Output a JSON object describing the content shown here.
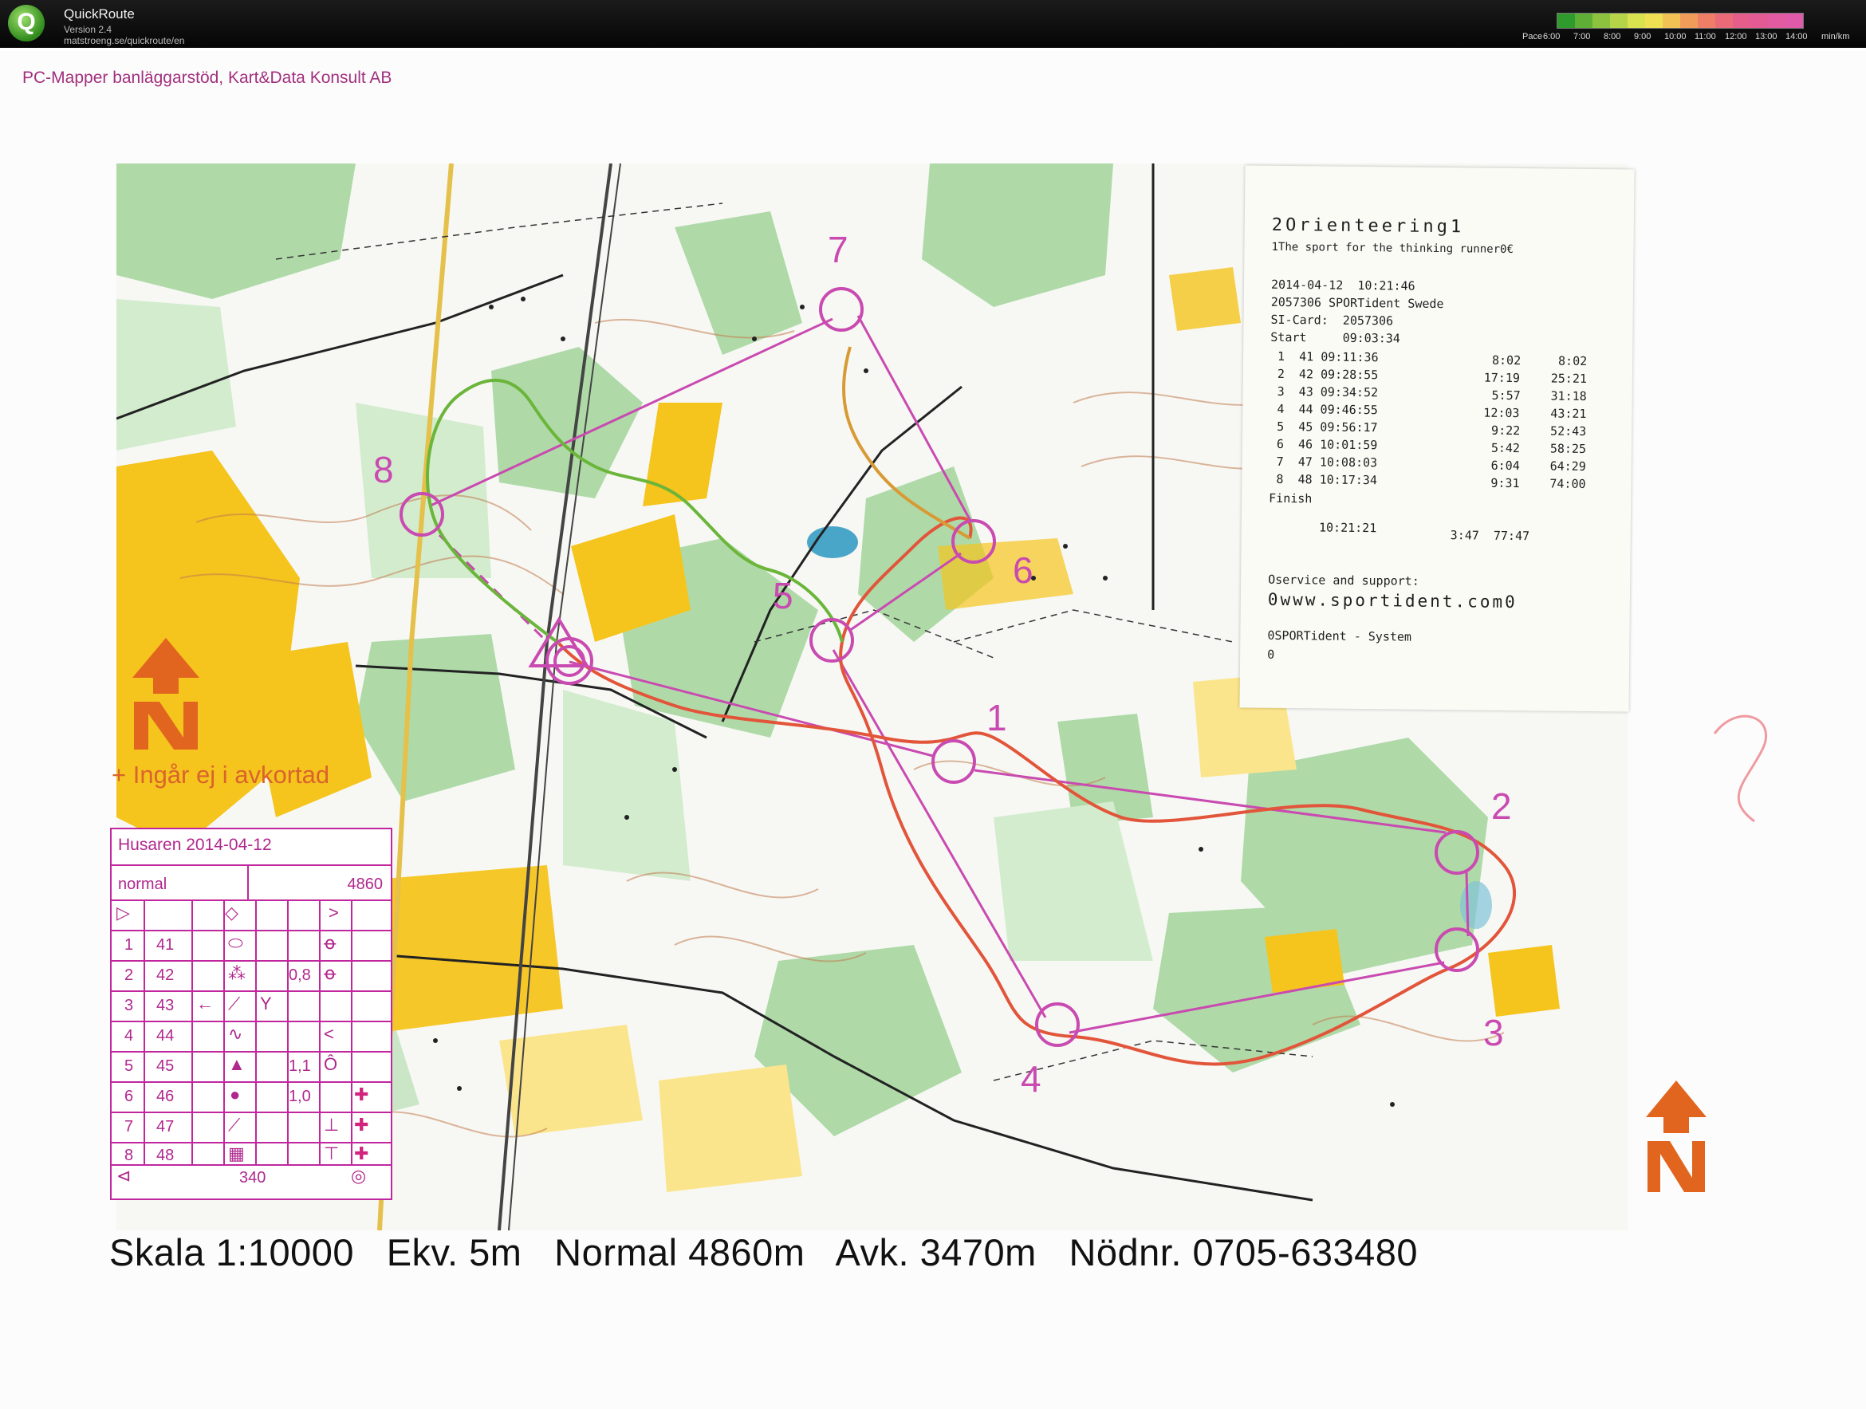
{
  "app": {
    "name": "QuickRoute",
    "version": "Version 2.4",
    "url": "matstroeng.se/quickroute/en",
    "logo_letter": "Q"
  },
  "pace_legend": {
    "label": "Pace",
    "ticks": [
      "6:00",
      "7:00",
      "8:00",
      "9:00",
      "10:00",
      "11:00",
      "12:00",
      "13:00",
      "14:00"
    ],
    "unit": "min/km",
    "colors": [
      "#2f9b2d",
      "#5fae35",
      "#8cc23e",
      "#b5d448",
      "#d9e24f",
      "#efe152",
      "#f3c255",
      "#f29c5a",
      "#ee7e66",
      "#ea6a78",
      "#e55d8a",
      "#e45a95",
      "#e25aa0",
      "#df5aa8"
    ]
  },
  "map": {
    "header_credit": "PC-Mapper banläggarstöd, Kart&Data Konsult AB",
    "orange_note": "+ Ingår ej i avkortad",
    "footer": "Skala 1:10000   Ekv. 5m   Normal 4860m   Avk. 3470m   Nödnr. 0705-633480",
    "control_numbers": [
      "1",
      "2",
      "3",
      "4",
      "5",
      "6",
      "7",
      "8"
    ],
    "colors": {
      "forest_green": "#9fd39a",
      "open_yellow": "#f7c424",
      "course_magenta": "#c94ab0",
      "route_red": "#e2553a",
      "north_orange": "#e2651f"
    }
  },
  "punch_card": {
    "line1": "2Orienteering1",
    "line2": "1The sport for the thinking runner0€",
    "datetime": "2014-04-12  10:21:46",
    "station": "2057306 SPORTident Swede",
    "sicard": "SI-Card:  2057306",
    "start": "Start     09:03:34",
    "splits": [
      {
        "row": " 1  41 09:11:36",
        "split": "8:02",
        "total": " 8:02"
      },
      {
        "row": " 2  42 09:28:55",
        "split": "17:19",
        "total": "25:21"
      },
      {
        "row": " 3  43 09:34:52",
        "split": "5:57",
        "total": "31:18"
      },
      {
        "row": " 4  44 09:46:55",
        "split": "12:03",
        "total": "43:21"
      },
      {
        "row": " 5  45 09:56:17",
        "split": "9:22",
        "total": "52:43"
      },
      {
        "row": " 6  46 10:01:59",
        "split": "5:42",
        "total": "58:25"
      },
      {
        "row": " 7  47 10:08:03",
        "split": "6:04",
        "total": "64:29"
      },
      {
        "row": " 8  48 10:17:34",
        "split": "9:31",
        "total": "74:00"
      }
    ],
    "finish_label": "Finish",
    "finish_time": "       10:21:21",
    "finish_split": "3:47  77:47",
    "service": "Oservice and support:",
    "website": "0www.sportident.com0",
    "system": "0SPORTident - System",
    "tail": "0"
  },
  "control_card": {
    "title": "Husaren 2014-04-12",
    "class": "normal",
    "length": "4860",
    "rows": [
      {
        "n": "1",
        "code": "41",
        "dist": ""
      },
      {
        "n": "2",
        "code": "42",
        "dist": "0,8"
      },
      {
        "n": "3",
        "code": "43",
        "dist": ""
      },
      {
        "n": "4",
        "code": "44",
        "dist": ""
      },
      {
        "n": "5",
        "code": "45",
        "dist": "1,1"
      },
      {
        "n": "6",
        "code": "46",
        "dist": "1,0"
      },
      {
        "n": "7",
        "code": "47",
        "dist": ""
      },
      {
        "n": "8",
        "code": "48",
        "dist": ""
      }
    ],
    "finish_distance": "340"
  }
}
